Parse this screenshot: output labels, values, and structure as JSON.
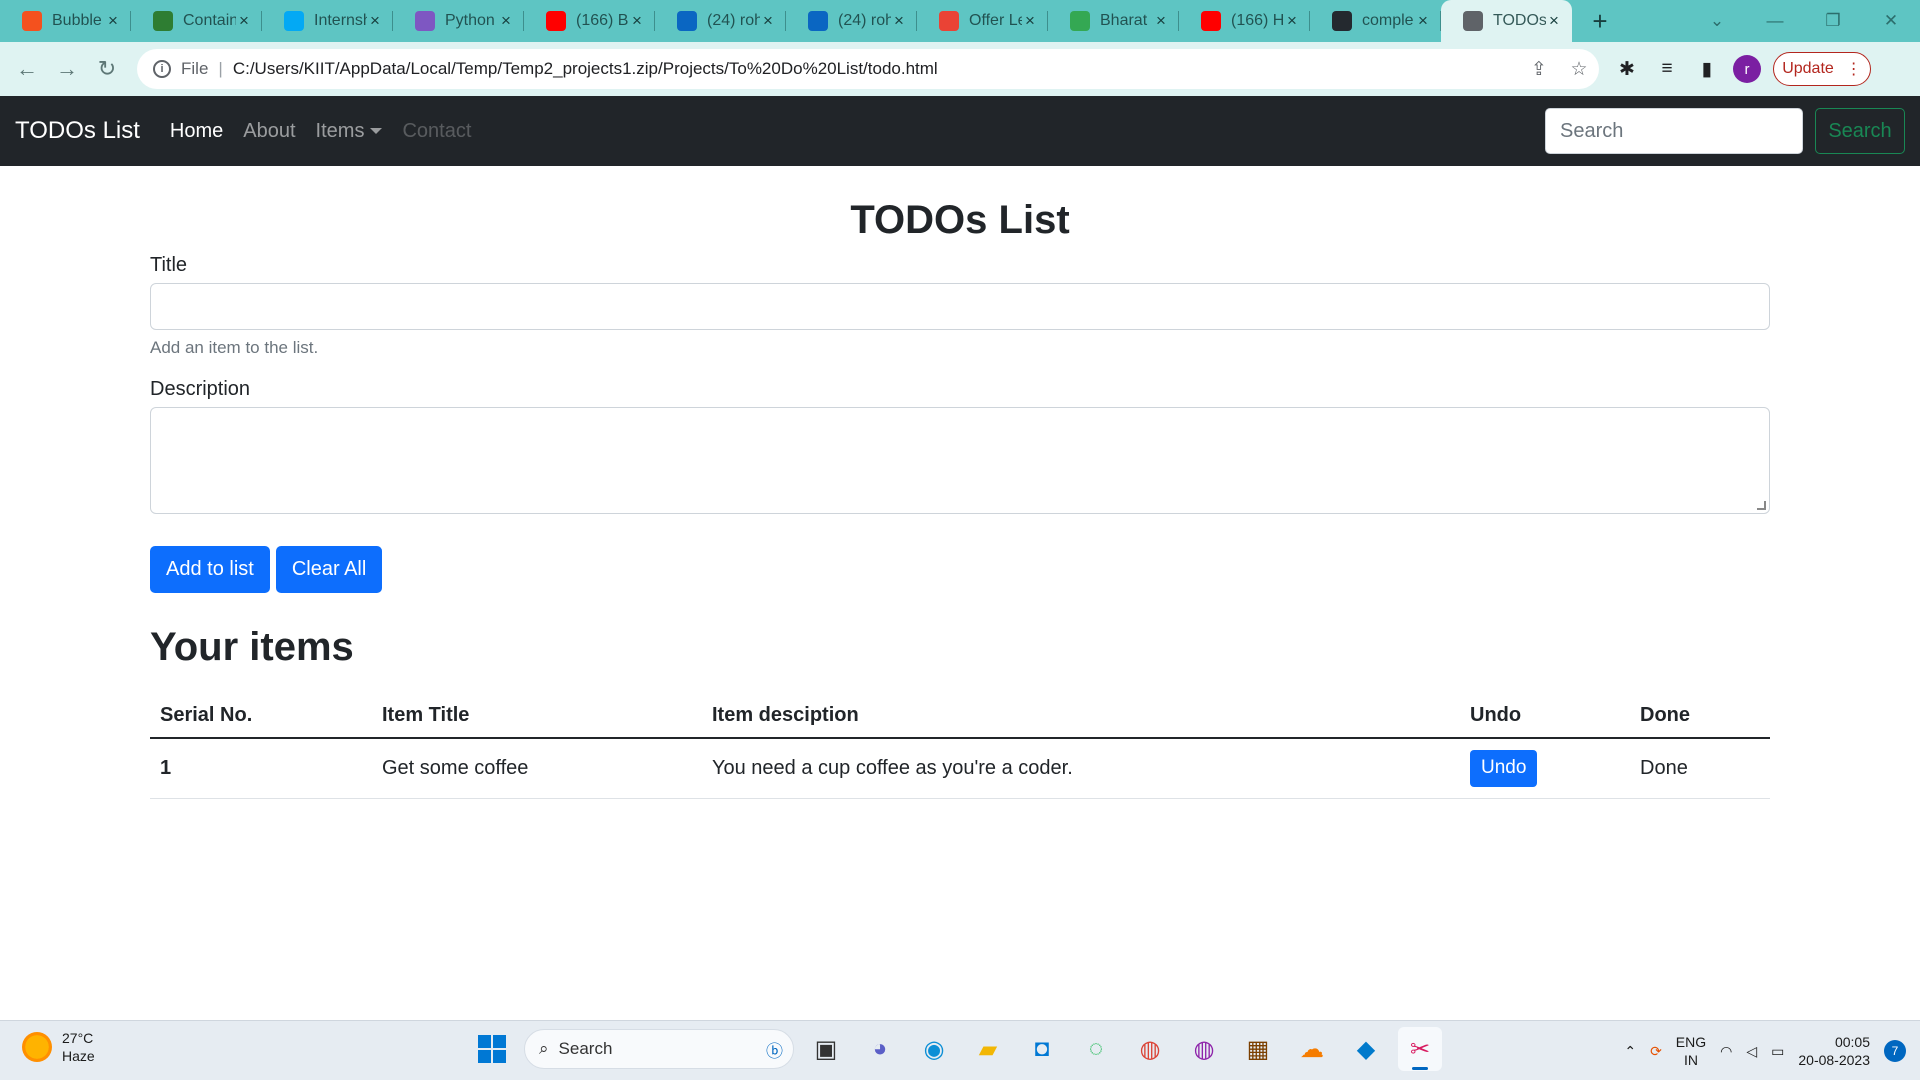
{
  "browser": {
    "tabs": [
      {
        "title": "Bubble",
        "icon": "bubble-icon",
        "color": "#f4511e"
      },
      {
        "title": "Contain",
        "icon": "contain-icon",
        "color": "#2e7d32"
      },
      {
        "title": "Internsh",
        "icon": "internshala-icon",
        "color": "#03a9f4"
      },
      {
        "title": "Python",
        "icon": "python-icon",
        "color": "#7e57c2"
      },
      {
        "title": "(166) B",
        "icon": "youtube-icon",
        "color": "#ff0000"
      },
      {
        "title": "(24) roh",
        "icon": "linkedin-icon",
        "color": "#0a66c2"
      },
      {
        "title": "(24) roh",
        "icon": "linkedin-icon",
        "color": "#0a66c2"
      },
      {
        "title": "Offer Le",
        "icon": "gmail-icon",
        "color": "#ea4335"
      },
      {
        "title": "Bharat I",
        "icon": "drive-icon",
        "color": "#34a853"
      },
      {
        "title": "(166) H",
        "icon": "youtube-icon",
        "color": "#ff0000"
      },
      {
        "title": "comple",
        "icon": "github-icon",
        "color": "#24292f"
      },
      {
        "title": "TODOs",
        "icon": "globe-icon",
        "color": "#5f6368"
      }
    ],
    "new_tab": "+",
    "scheme": "File",
    "url": "C:/Users/KIIT/AppData/Local/Temp/Temp2_projects1.zip/Projects/To%20Do%20List/todo.html",
    "profile_initial": "r",
    "update_label": "Update"
  },
  "navbar": {
    "brand": "TODOs List",
    "links": {
      "home": "Home",
      "about": "About",
      "items": "Items",
      "contact": "Contact"
    },
    "search_placeholder": "Search",
    "search_button": "Search"
  },
  "main": {
    "heading": "TODOs List",
    "title_label": "Title",
    "title_help": "Add an item to the list.",
    "description_label": "Description",
    "add_button": "Add to list",
    "clear_button": "Clear All",
    "items_heading": "Your items",
    "table": {
      "headers": [
        "Serial No.",
        "Item Title",
        "Item desciption",
        "Undo",
        "Done"
      ],
      "rows": [
        {
          "serial": "1",
          "title": "Get some coffee",
          "description": "You need a cup coffee as you're a coder.",
          "undo_label": "Undo",
          "done": "Done"
        }
      ]
    }
  },
  "taskbar": {
    "temperature": "27°C",
    "weather": "Haze",
    "search_placeholder": "Search",
    "lang_top": "ENG",
    "lang_bottom": "IN",
    "time": "00:05",
    "date": "20-08-2023",
    "notifications": "7"
  },
  "colors": {
    "primary": "#0d6efd",
    "navbar": "#212529",
    "success": "#198754",
    "tabstrip": "#5ec5c3"
  }
}
